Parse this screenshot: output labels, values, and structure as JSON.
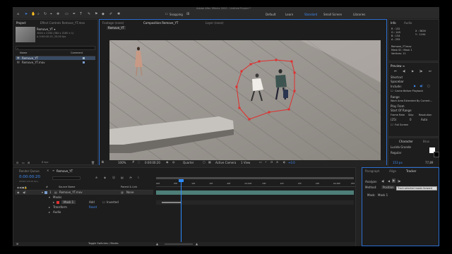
{
  "window": {
    "title": "Adobe After Effects 2020 - Untitled Project *"
  },
  "toolbar": {
    "snapping_label": "Snapping",
    "workspaces": [
      "Default",
      "Learn",
      "Standard",
      "Small Screen",
      "Libraries"
    ],
    "active_workspace": "Standard"
  },
  "project": {
    "tab": "Project",
    "effect_tab": "Effect Controls Remove_YT.mov",
    "footage_name": "Remove_YT ▾",
    "footage_info": [
      "3840 x 2160 (384 x 2160 x 1)",
      "Δ 0:00:00:15, 25.00 fps"
    ],
    "search_placeholder": "⌕",
    "col_name": "Name",
    "col_comment": "Comment",
    "items": [
      "Remove_YT",
      "Remove_YT.mov"
    ]
  },
  "viewer": {
    "tabs": [
      "Footage (none)",
      "Composition Remove_YT",
      "Layer (none)"
    ],
    "breadcrumb": "Remove_YT",
    "zoom": "100%",
    "timecode": "0:00:00:20",
    "resolution": "Quarter",
    "camera": "Active Camera",
    "views": "1 View",
    "exposure": "+0.0"
  },
  "info": {
    "tab": "Info",
    "audio_tab": "Audio",
    "r": "R : 132",
    "g": "G : 149",
    "b": "B : 134",
    "a": "A : 255",
    "x": "X : 3626",
    "y": "Y : 1194",
    "lines": [
      "Remove_YT.mov",
      "Mask ID : Mask 1",
      "Vertices: 11"
    ]
  },
  "preview": {
    "title": "Preview ≡",
    "shortcut_label": "Shortcut",
    "shortcut_value": "Spacebar",
    "include_label": "Include:",
    "cache_label": "Cache Before Playback",
    "range_label": "Range",
    "range_value": "Work Area Extended By Current...",
    "play_from_label": "Play From",
    "play_from_value": "Start Of Range",
    "frame_rate_label": "Frame Rate",
    "skip_label": "Skip",
    "resolution_label": "Resolution",
    "frame_rate_value": "(25)",
    "skip_value": "0",
    "resolution_value": "Auto",
    "fullscreen_label": "Full Screen"
  },
  "character": {
    "tabs": [
      "Character",
      "Brus"
    ],
    "font": "Lucida Grande",
    "style": "Regular",
    "size": "153 px",
    "leading": "77,89"
  },
  "timeline": {
    "render_queue_tab": "Render Queue",
    "comp_tab": "Remove_YT",
    "timecode": "0:00:00:20",
    "frame_info": "00020 (25.00 fps)",
    "columns": [
      "#",
      "Source Name",
      "Parent & Link"
    ],
    "layer_num": "1",
    "layer_name": "Remove_YT.mov",
    "parent_value": "None",
    "masks_label": "Masks",
    "mask_name": "Mask 1",
    "mask_mode": "Add",
    "mask_inverted": "Inverted",
    "transform_label": "Transform",
    "transform_reset": "Reset",
    "audio_label": "Audio",
    "ruler": [
      "00f",
      "05f",
      "10f",
      "15f",
      "20f",
      "01:00f",
      "05f",
      "10f",
      "15f",
      "20f",
      "02:00f",
      "05f"
    ],
    "bottom_label": "Toggle Switches / Modes",
    "bits_label": "8 bpc"
  },
  "tracker": {
    "tabs": [
      "Paragraph",
      "Align",
      "Tracker"
    ],
    "analyze_label": "Analyze:",
    "method_label": "Method:",
    "method_value": "Position",
    "tooltip": "Track selected masks forward",
    "mask_label": "Mask:",
    "mask_value": "Mask 1"
  },
  "colors": {
    "accent": "#2d8cff",
    "panel": "#1d1d1d",
    "mask": "#e03030",
    "layer_bar": "#4e7e78"
  }
}
